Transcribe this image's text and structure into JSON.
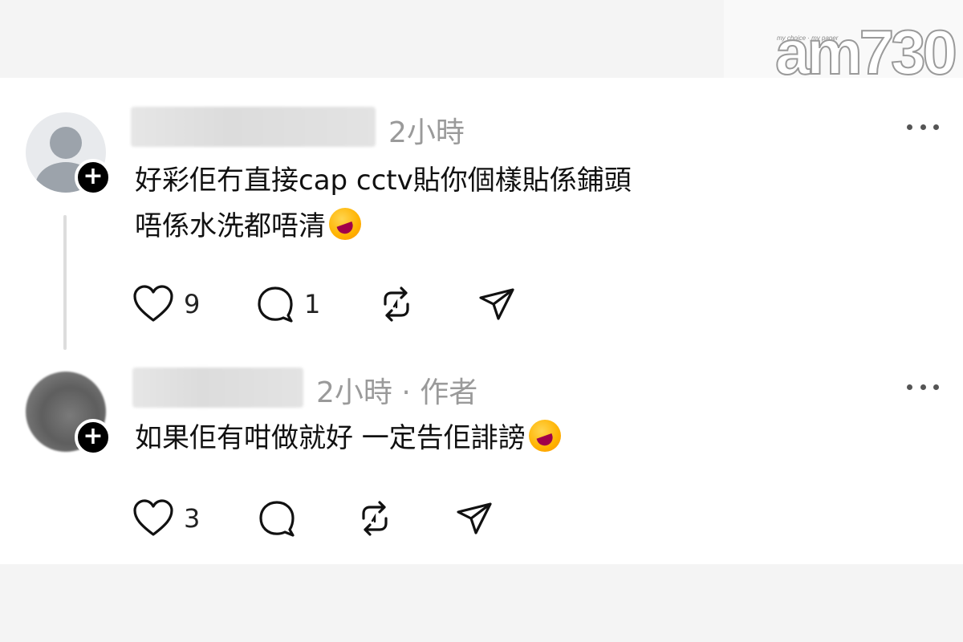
{
  "logo": {
    "text": "am730",
    "tagline": "my choice · my paper"
  },
  "comments": [
    {
      "time": "2小時",
      "text_line1": "好彩佢冇直接cap cctv貼你個樣貼係鋪頭",
      "text_line2": "唔係水洗都唔清",
      "likes": "9",
      "replies": "1",
      "emoji": "rolling-on-floor-laughing"
    },
    {
      "time": "2小時 · 作者",
      "text_line1": "如果佢有咁做就好 一定告佢誹謗",
      "likes": "3",
      "replies": "",
      "emoji": "rolling-on-floor-laughing"
    }
  ],
  "colors": {
    "meta": "#9a9a9a",
    "text": "#111111",
    "panel": "#ffffff",
    "frame": "#f4f4f4"
  }
}
